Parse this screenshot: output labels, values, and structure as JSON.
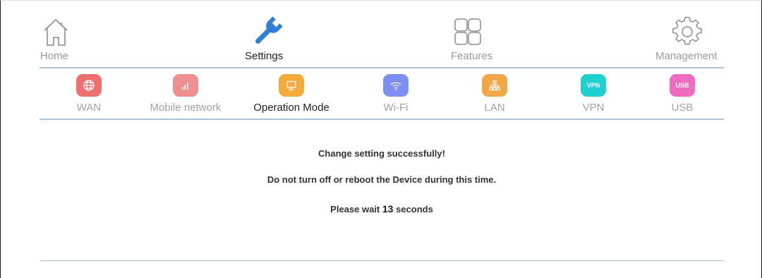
{
  "top_nav": {
    "items": [
      {
        "label": "Home",
        "icon": "home-icon"
      },
      {
        "label": "Settings",
        "icon": "wrench-icon",
        "active": true
      },
      {
        "label": "Features",
        "icon": "grid-icon"
      },
      {
        "label": "Management",
        "icon": "gear-icon"
      }
    ]
  },
  "sub_nav": {
    "items": [
      {
        "label": "WAN",
        "icon": "globe-icon",
        "color": "#ef6f6f"
      },
      {
        "label": "Mobile network",
        "icon": "signal-bars-icon",
        "color": "#f08f8f"
      },
      {
        "label": "Operation Mode",
        "icon": "monitor-icon",
        "color": "#f4ab3c",
        "active": true
      },
      {
        "label": "Wi-Fi",
        "icon": "wifi-icon",
        "color": "#7e8ff4"
      },
      {
        "label": "LAN",
        "icon": "network-tree-icon",
        "color": "#f3a646"
      },
      {
        "label": "VPN",
        "badge_text": "VPN",
        "color": "#20d0cf"
      },
      {
        "label": "USB",
        "badge_text": "USB",
        "color": "#f06cc0"
      }
    ]
  },
  "message": {
    "success": "Change setting successfully!",
    "warning": "Do not turn off or reboot the Device during this time.",
    "wait_prefix": "Please wait",
    "wait_seconds": "13",
    "wait_suffix": "seconds"
  }
}
